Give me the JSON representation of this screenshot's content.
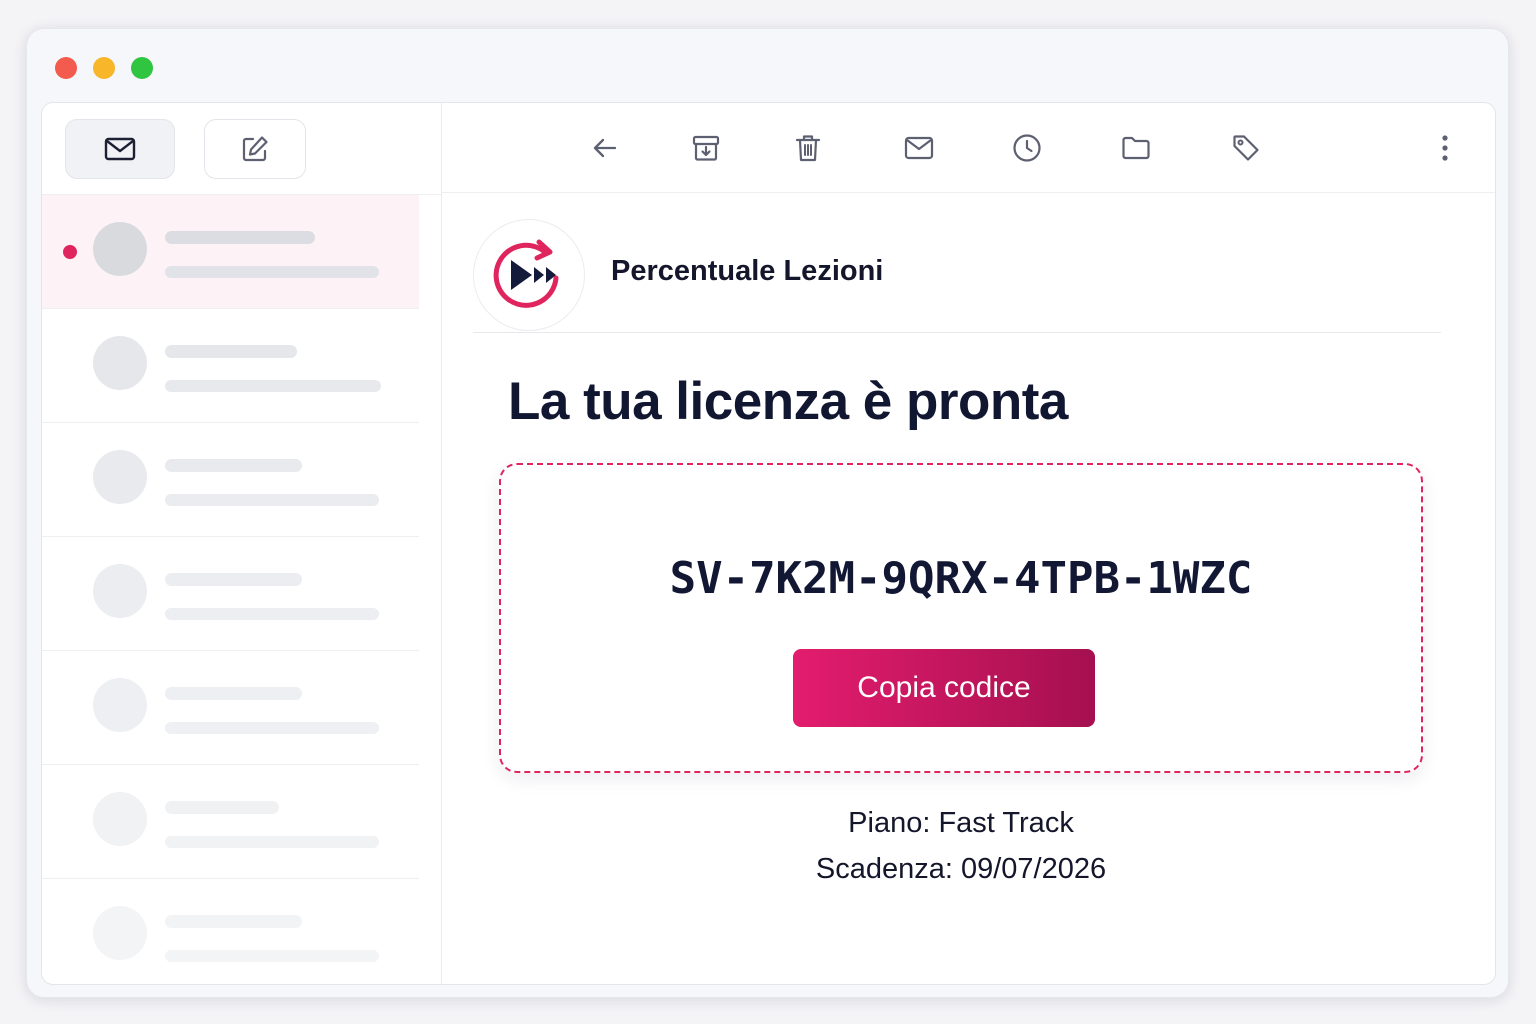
{
  "colors": {
    "close": "#f25b4d",
    "minimize": "#f8b62b",
    "maximize": "#2fc541",
    "accent": "#e0245e",
    "text_dark": "#121734"
  },
  "sidebar": {
    "buttons": [
      {
        "icon": "mail-icon"
      },
      {
        "icon": "compose-icon"
      }
    ]
  },
  "toolbar": {
    "icons": [
      "back-arrow-icon",
      "archive-icon",
      "trash-icon",
      "mail-icon",
      "clock-icon",
      "folder-icon",
      "tag-icon",
      "more-vertical-icon"
    ]
  },
  "email": {
    "sender_name": "Percentuale Lezioni",
    "logo_icon": "replay-fast-forward-logo",
    "heading": "La tua licenza è pronta",
    "license_code": "SV-7K2M-9QRX-4TPB-1WZC",
    "copy_button_label": "Copia codice",
    "plan_line": "Piano: Fast Track",
    "expiry_line": "Scadenza: 09/07/2026"
  }
}
